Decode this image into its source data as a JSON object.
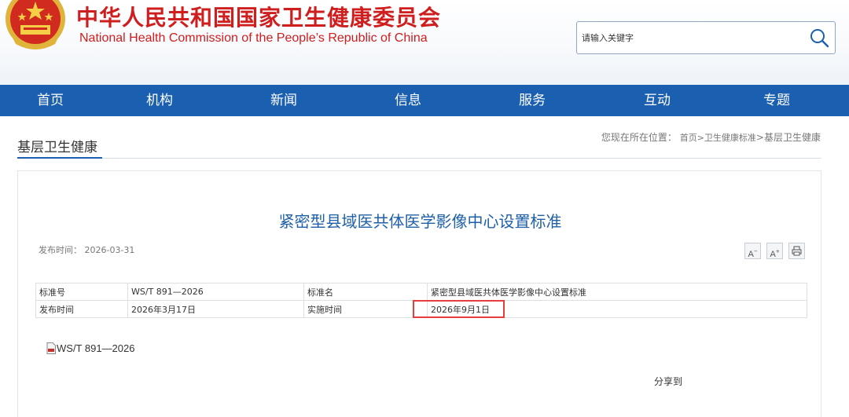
{
  "header": {
    "title_cn": "中华人民共和国国家卫生健康委员会",
    "title_en": "National Health Commission of the People’s  Republic of China",
    "search": {
      "placeholder": "请输入关键字"
    }
  },
  "colors": {
    "brand_red": "#cf1e1e",
    "nav_blue": "#1b5fb0",
    "title_blue": "#1f5fa8",
    "highlight_red": "#e83d3d"
  },
  "icons": {
    "emblem": "national-emblem-icon",
    "search": "search-icon",
    "font_decrease": "font-decrease-icon",
    "font_increase": "font-increase-icon",
    "print": "print-icon",
    "attachment": "pdf-file-icon"
  },
  "nav": {
    "items": [
      {
        "label": "首页"
      },
      {
        "label": "机构"
      },
      {
        "label": "新闻"
      },
      {
        "label": "信息"
      },
      {
        "label": "服务"
      },
      {
        "label": "互动"
      },
      {
        "label": "专题"
      }
    ]
  },
  "section": {
    "title": "基层卫生健康"
  },
  "breadcrumb": {
    "prefix": "您现在所在位置：",
    "home": "首页",
    "sep1": ">",
    "level1": "卫生健康标准",
    "sep2": ">",
    "current": "基层卫生健康"
  },
  "article": {
    "title": "紧密型县域医共体医学影像中心设置标准",
    "pub_date_label": "发布时间：",
    "pub_date": "2026-03-31",
    "tools": {
      "decrease": "A",
      "increase": "A"
    },
    "info": {
      "row1": {
        "k1": "标准号",
        "v1": "WS/T 891—2026",
        "k2": "标准名",
        "v2": "紧密型县域医共体医学影像中心设置标准"
      },
      "row2": {
        "k1": "发布时间",
        "v1": "2026年3月17日",
        "k2": "实施时间",
        "v2": "2026年9月1日"
      }
    },
    "attachment": "WS/T 891—2026",
    "share_label": "分享到"
  }
}
